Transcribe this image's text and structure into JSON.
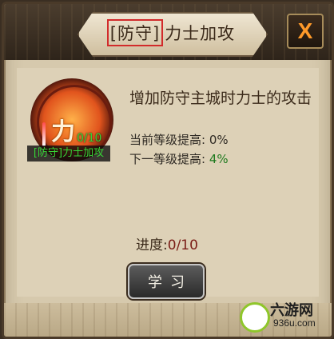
{
  "dialog": {
    "title_tag": "[防守]",
    "title_rest": "力士加攻",
    "close_label": "X"
  },
  "skill": {
    "icon_char": "力",
    "progress_small": "0/10",
    "label": "[防守]力士加攻",
    "description": "增加防守主城时力士的攻击",
    "current_level_label": "当前等级提高: ",
    "current_level_value": "0%",
    "next_level_label": "下一等级提高: ",
    "next_level_value": "4%"
  },
  "progress": {
    "label": "进度:",
    "value": "0/10"
  },
  "actions": {
    "learn_label": "学习"
  },
  "watermark": {
    "main": "六游网",
    "url": "936u.com"
  },
  "colors": {
    "title_highlight": "#d22b2b",
    "green_text": "#36d336",
    "progress_value": "#7a1d16"
  }
}
